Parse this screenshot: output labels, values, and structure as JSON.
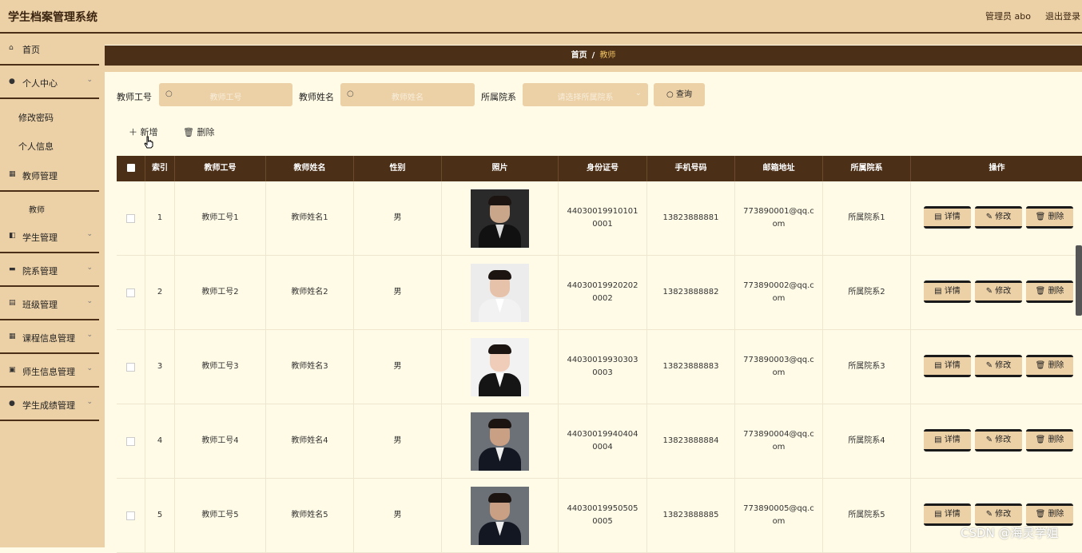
{
  "header": {
    "title": "学生档案管理系统",
    "admin": "管理员 abo",
    "logout": "退出登录"
  },
  "sidebar": {
    "items": [
      {
        "label": "首页",
        "icon": "home-icon"
      },
      {
        "label": "个人中心",
        "icon": "user-icon"
      },
      {
        "label": "教师管理",
        "icon": "grid-icon"
      },
      {
        "label": "学生管理",
        "icon": "student-icon"
      },
      {
        "label": "院系管理",
        "icon": "building-icon"
      },
      {
        "label": "班级管理",
        "icon": "class-icon"
      },
      {
        "label": "课程信息管理",
        "icon": "grid-icon"
      },
      {
        "label": "师生信息管理",
        "icon": "chart-icon"
      },
      {
        "label": "学生成绩管理",
        "icon": "pin-icon"
      }
    ],
    "sub_personal": [
      "修改密码",
      "个人信息"
    ],
    "sub_teacher": [
      "教师"
    ]
  },
  "breadcrumb": {
    "home": "首页",
    "sep": "/",
    "current": "教师"
  },
  "search": {
    "id_label": "教师工号",
    "id_placeholder": "教师工号",
    "name_label": "教师姓名",
    "name_placeholder": "教师姓名",
    "dept_label": "所属院系",
    "dept_placeholder": "请选择所属院系",
    "button": "查询"
  },
  "actions": {
    "add": "新增",
    "delete": "删除"
  },
  "table": {
    "columns": [
      "索引",
      "教师工号",
      "教师姓名",
      "性别",
      "照片",
      "身份证号",
      "手机号码",
      "邮箱地址",
      "所属院系",
      "操作"
    ],
    "ops": {
      "detail": "详情",
      "edit": "修改",
      "delete": "删除"
    },
    "rows": [
      {
        "index": "1",
        "id": "教师工号1",
        "name": "教师姓名1",
        "gender": "男",
        "idcard": "440300199101010001",
        "phone": "13823888881",
        "email": "773890001@qq.com",
        "dept": "所属院系1"
      },
      {
        "index": "2",
        "id": "教师工号2",
        "name": "教师姓名2",
        "gender": "男",
        "idcard": "440300199202020002",
        "phone": "13823888882",
        "email": "773890002@qq.com",
        "dept": "所属院系2"
      },
      {
        "index": "3",
        "id": "教师工号3",
        "name": "教师姓名3",
        "gender": "男",
        "idcard": "440300199303030003",
        "phone": "13823888883",
        "email": "773890003@qq.com",
        "dept": "所属院系3"
      },
      {
        "index": "4",
        "id": "教师工号4",
        "name": "教师姓名4",
        "gender": "男",
        "idcard": "440300199404040004",
        "phone": "13823888884",
        "email": "773890004@qq.com",
        "dept": "所属院系4"
      },
      {
        "index": "5",
        "id": "教师工号5",
        "name": "教师姓名5",
        "gender": "男",
        "idcard": "440300199505050005",
        "phone": "13823888885",
        "email": "773890005@qq.com",
        "dept": "所属院系5"
      }
    ]
  },
  "watermark": "CSDN @海灵学姐",
  "colors": {
    "accent": "#4b2f17",
    "tan": "#ecd0a6",
    "bg": "#fffbe6"
  }
}
